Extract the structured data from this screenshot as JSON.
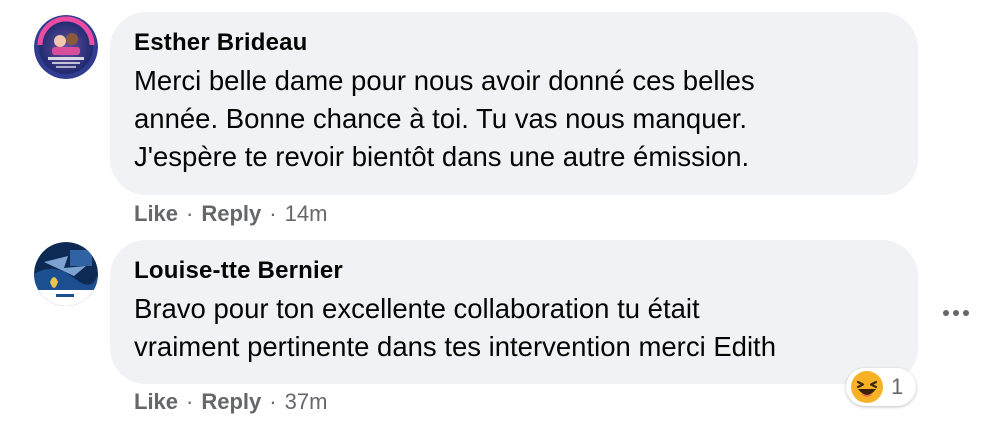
{
  "comments": [
    {
      "author": "Esther Brideau",
      "avatar_alt": "profile-photo",
      "lines": [
        "Merci belle dame pour nous avoir donné ces belles",
        "année. Bonne chance à toi. Tu vas nous manquer.",
        "J'espère te revoir bientôt dans une autre émission."
      ],
      "like_label": "Like",
      "reply_label": "Reply",
      "separator": "·",
      "timestamp": "14m"
    },
    {
      "author": "Louise-tte Bernier",
      "avatar_alt": "profile-photo",
      "lines": [
        "Bravo pour ton excellente collaboration tu était",
        "vraiment pertinente dans tes intervention merci Edith"
      ],
      "like_label": "Like",
      "reply_label": "Reply",
      "separator": "·",
      "timestamp": "37m",
      "reaction": {
        "icon": "haha-emoji-icon",
        "count": "1"
      }
    }
  ],
  "colors": {
    "bubble_bg": "#f0f2f5",
    "meta_text": "#65676b",
    "text": "#050505"
  }
}
